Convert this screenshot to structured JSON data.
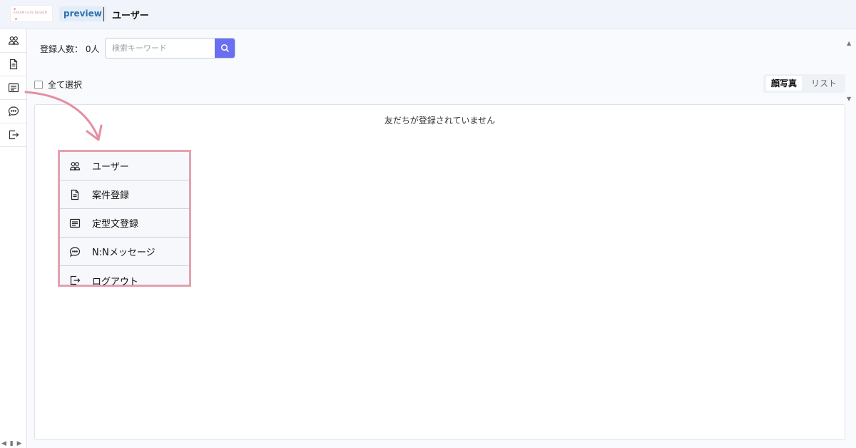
{
  "header": {
    "logo_text": "KAKUMI LIFE DESIGN",
    "badge": "preview",
    "title": "ユーザー"
  },
  "sidebar": {
    "items": [
      {
        "name": "users",
        "icon": "users-icon"
      },
      {
        "name": "document",
        "icon": "document-icon"
      },
      {
        "name": "template",
        "icon": "list-icon"
      },
      {
        "name": "message",
        "icon": "chat-icon"
      },
      {
        "name": "logout",
        "icon": "logout-icon"
      }
    ],
    "bottom_controls": "◀ ▮ ▶"
  },
  "toolbar": {
    "count_label": "登録人数： 0人",
    "search_placeholder": "検索キーワード",
    "select_all_label": "全て選択",
    "view_face": "顔写真",
    "view_list": "リスト"
  },
  "content": {
    "empty_message": "友だちが登録されていません"
  },
  "callout": {
    "items": [
      {
        "icon": "users-icon",
        "label": "ユーザー"
      },
      {
        "icon": "document-icon",
        "label": "案件登録"
      },
      {
        "icon": "list-icon",
        "label": "定型文登録"
      },
      {
        "icon": "chat-icon",
        "label": "N:Nメッセージ"
      },
      {
        "icon": "logout-icon",
        "label": "ログアウト"
      }
    ]
  },
  "colors": {
    "accent": "#6a6ef0",
    "highlight_border": "#e4a1ae",
    "badge_bg": "#e2edf8"
  }
}
